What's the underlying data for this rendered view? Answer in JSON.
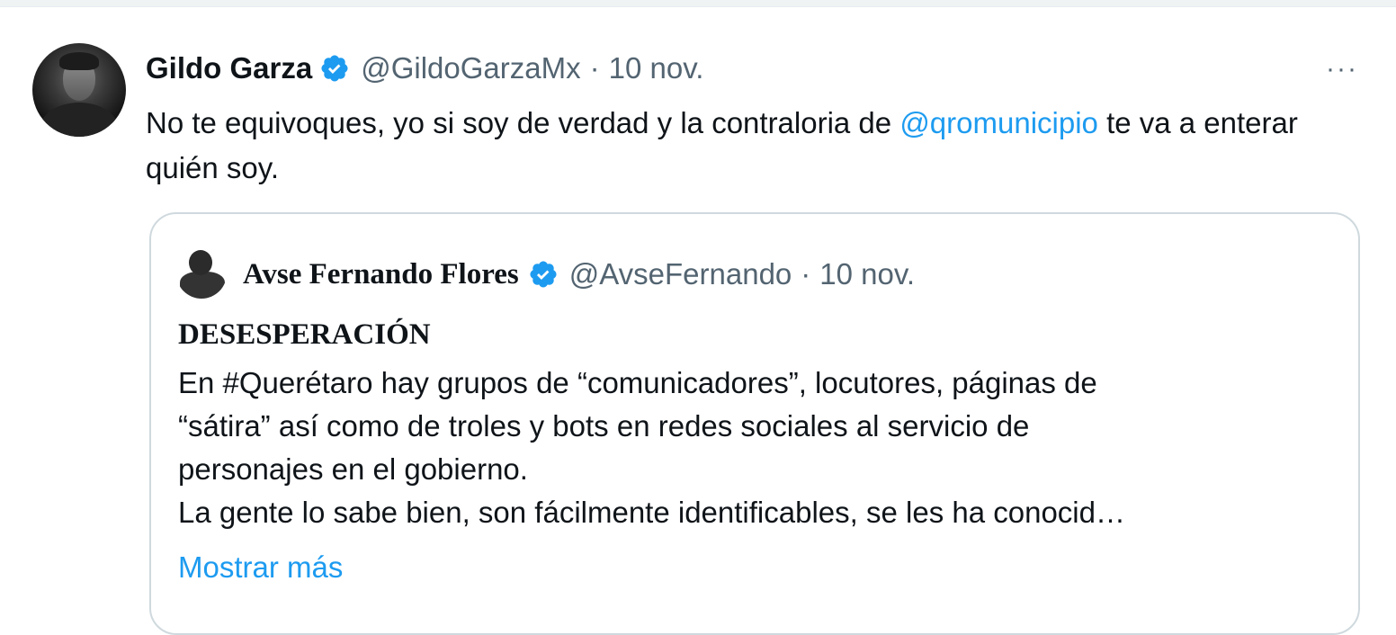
{
  "tweet": {
    "display_name": "Gildo Garza",
    "handle": "@GildoGarzaMx",
    "separator": "·",
    "date": "10 nov.",
    "more_icon": "···",
    "text_before": "No te equivoques, yo si soy de verdad y la contraloria de ",
    "mention": "@qromunicipio",
    "text_after": " te va a enterar quién soy."
  },
  "quoted": {
    "display_name": "Avse Fernando Flores",
    "handle": "@AvseFernando",
    "separator": "·",
    "date": "10 nov.",
    "title": "DESESPERACIÓN",
    "lines": [
      "En #Querétaro hay grupos de “comunicadores”, locutores, páginas de",
      "“sátira” así como de troles y bots en redes sociales al servicio de",
      "personajes en el gobierno.",
      "La gente lo sabe bien, son fácilmente identificables, se les ha conocid…"
    ],
    "show_more": "Mostrar más"
  },
  "colors": {
    "verified": "#1d9bf0",
    "link": "#1d9bf0",
    "secondary_text": "#536471"
  },
  "icons": {
    "verified": "verified-badge-icon",
    "more": "more-horizontal-icon"
  }
}
